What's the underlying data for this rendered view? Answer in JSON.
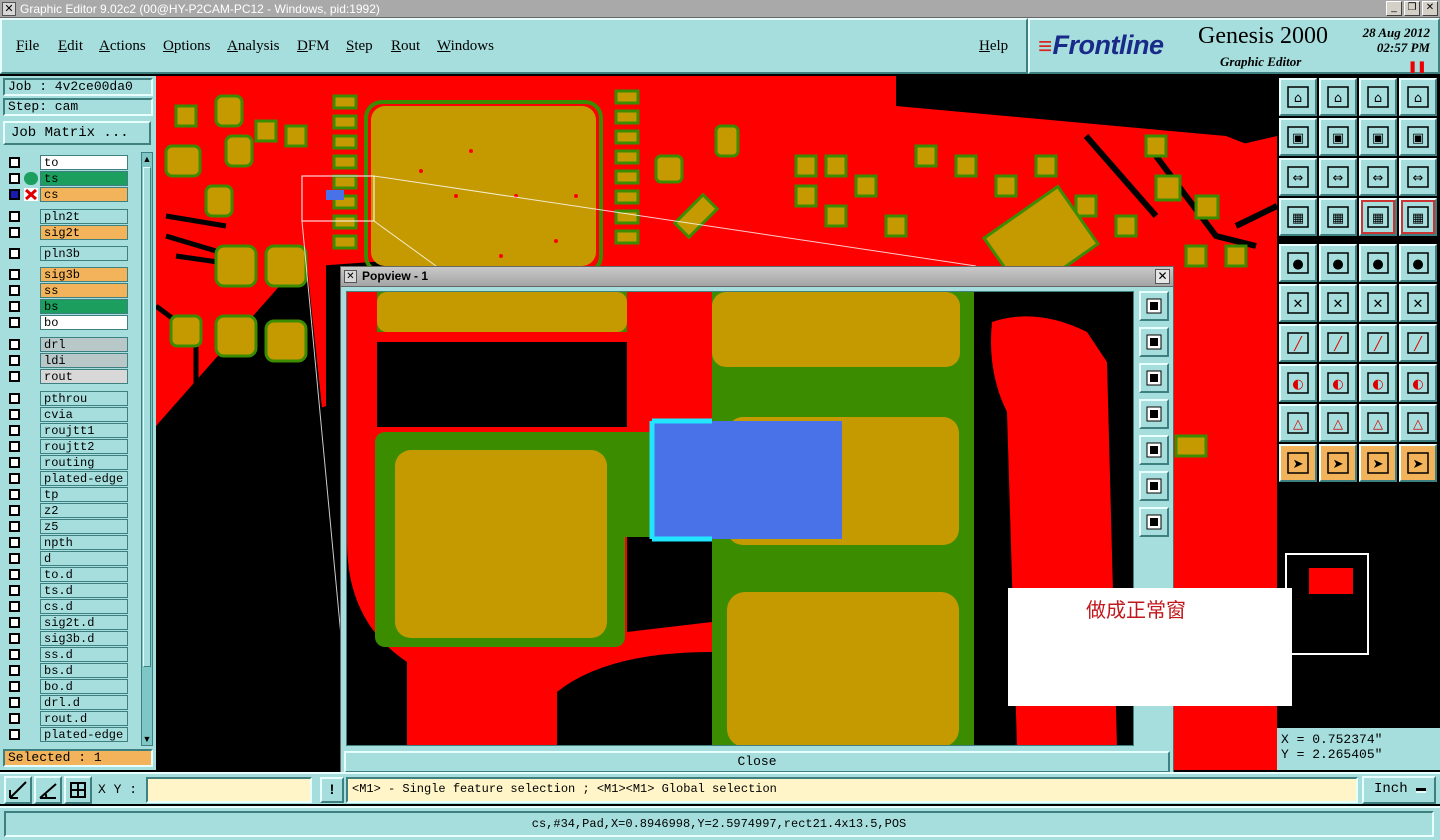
{
  "window": {
    "title": "Graphic Editor 9.02c2 (00@HY-P2CAM-PC12 - Windows, pid:1992)"
  },
  "menu": {
    "items": [
      "File",
      "Edit",
      "Actions",
      "Options",
      "Analysis",
      "DFM",
      "Step",
      "Rout",
      "Windows"
    ],
    "help": "Help"
  },
  "brand": {
    "logo": "Frontline",
    "product": "Genesis 2000",
    "subtitle": "Graphic Editor",
    "date": "28 Aug 2012",
    "time": "02:57 PM"
  },
  "job": {
    "job_label": "Job : 4v2ce00da0",
    "step_label": "Step: cam",
    "matrix_button": "Job Matrix ..."
  },
  "layers": [
    {
      "name": "to",
      "color": "#ffffff"
    },
    {
      "name": "ts",
      "color": "#1b9e5e"
    },
    {
      "name": "cs",
      "color": "#f2b35a"
    },
    {
      "name": "pln2t",
      "color": "#a6dedd"
    },
    {
      "name": "sig2t",
      "color": "#f2b35a"
    },
    {
      "name": "pln3b",
      "color": "#a6dedd"
    },
    {
      "name": "sig3b",
      "color": "#f2b35a"
    },
    {
      "name": "ss",
      "color": "#f2b35a"
    },
    {
      "name": "bs",
      "color": "#1b9e5e"
    },
    {
      "name": "bo",
      "color": "#ffffff"
    },
    {
      "name": "drl",
      "color": "#b8c8c8"
    },
    {
      "name": "ldi",
      "color": "#b8c8c8"
    },
    {
      "name": "rout",
      "color": "#d8d8d8"
    },
    {
      "name": "pthrou",
      "color": "#a6dedd"
    },
    {
      "name": "cvia",
      "color": "#a6dedd"
    },
    {
      "name": "roujtt1",
      "color": "#a6dedd"
    },
    {
      "name": "roujtt2",
      "color": "#a6dedd"
    },
    {
      "name": "routing",
      "color": "#a6dedd"
    },
    {
      "name": "plated-edge",
      "color": "#a6dedd"
    },
    {
      "name": "tp",
      "color": "#a6dedd"
    },
    {
      "name": "z2",
      "color": "#a6dedd"
    },
    {
      "name": "z5",
      "color": "#a6dedd"
    },
    {
      "name": "npth",
      "color": "#a6dedd"
    },
    {
      "name": "d",
      "color": "#a6dedd"
    },
    {
      "name": "to.d",
      "color": "#a6dedd"
    },
    {
      "name": "ts.d",
      "color": "#a6dedd"
    },
    {
      "name": "cs.d",
      "color": "#a6dedd"
    },
    {
      "name": "sig2t.d",
      "color": "#a6dedd"
    },
    {
      "name": "sig3b.d",
      "color": "#a6dedd"
    },
    {
      "name": "ss.d",
      "color": "#a6dedd"
    },
    {
      "name": "bs.d",
      "color": "#a6dedd"
    },
    {
      "name": "bo.d",
      "color": "#a6dedd"
    },
    {
      "name": "drl.d",
      "color": "#a6dedd"
    },
    {
      "name": "rout.d",
      "color": "#a6dedd"
    },
    {
      "name": "plated-edge",
      "color": "#a6dedd"
    }
  ],
  "selected": "Selected : 1",
  "popview": {
    "title": "Popview - 1",
    "close_label": "Close"
  },
  "annotation": {
    "text": "做成正常窗"
  },
  "coords": {
    "x": "X = 0.752374\"",
    "y": "Y = 2.265405\""
  },
  "bottom": {
    "xy_label": "X Y :",
    "xy_value": "",
    "prompt": "<M1> - Single feature selection ; <M1><M1> Global selection",
    "units": "Inch",
    "status": "cs,#34,Pad,X=0.8946998,Y=2.5974997,rect21.4x13.5,POS"
  },
  "colors": {
    "panel": "#a6dedd",
    "copper": "#ff0000",
    "pad": "#c49a00",
    "mask": "#3c8c00",
    "selection": "#4a72e8",
    "highlight": "#f2b35a"
  }
}
